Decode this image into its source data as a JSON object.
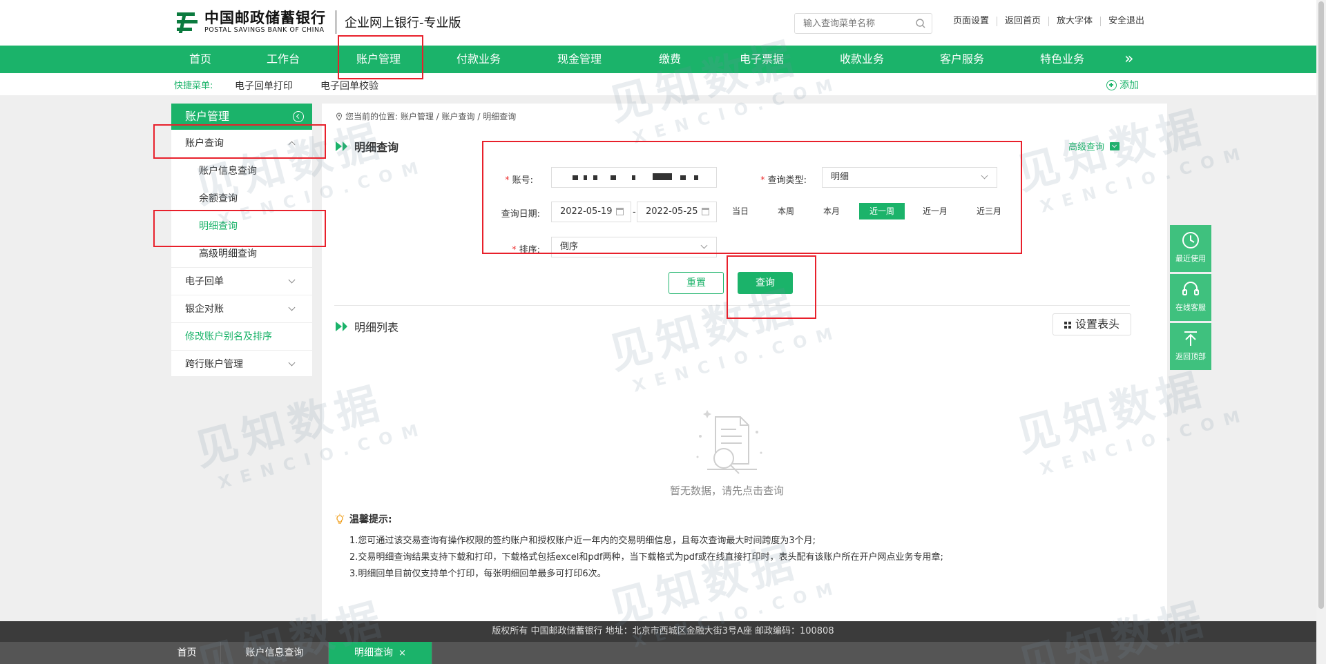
{
  "header": {
    "bank_name_cn": "中国邮政储蓄银行",
    "bank_name_en": "POSTAL SAVINGS BANK OF CHINA",
    "subtitle": "企业网上银行-专业版",
    "search_placeholder": "输入查询菜单名称",
    "links": [
      "页面设置",
      "返回首页",
      "放大字体",
      "安全退出"
    ]
  },
  "nav": {
    "items": [
      "首页",
      "工作台",
      "账户管理",
      "付款业务",
      "现金管理",
      "缴费",
      "电子票据",
      "收款业务",
      "客户服务",
      "特色业务"
    ],
    "more": "»"
  },
  "quickbar": {
    "label": "快捷菜单:",
    "items": [
      "电子回单打印",
      "电子回单校验"
    ],
    "add": "添加"
  },
  "sidebar": {
    "title": "账户管理",
    "group1": "账户查询",
    "sub": [
      "账户信息查询",
      "余额查询",
      "明细查询",
      "高级明细查询"
    ],
    "items": [
      "电子回单",
      "银企对账",
      "修改账户别名及排序",
      "跨行账户管理"
    ]
  },
  "breadcrumb": "您当前的位置: 账户管理 / 账户查询 / 明细查询",
  "query": {
    "title": "明细查询",
    "advanced": "高级查询",
    "account_label": "账号:",
    "type_label": "查询类型:",
    "type_value": "明细",
    "date_label": "查询日期:",
    "date_from": "2022-05-19",
    "date_to": "2022-05-25",
    "date_sep": "-",
    "quick_ranges": [
      "当日",
      "本周",
      "本月",
      "近一周",
      "近一月",
      "近三月"
    ],
    "active_range": "近一周",
    "sort_label": "排序:",
    "sort_value": "倒序",
    "reset": "重置",
    "submit": "查询"
  },
  "list": {
    "title": "明细列表",
    "settings": "设置表头",
    "empty": "暂无数据，请先点击查询"
  },
  "tips": {
    "title": "温馨提示:",
    "lines": [
      "1.您可通过该交易查询有操作权限的签约账户和授权账户近一年内的交易明细信息，且每次查询最大时间跨度为3个月;",
      "2.交易明细查询结果支持下载和打印，下载格式包括excel和pdf两种，当下载格式为pdf或在线直接打印时，表头配有该账户所在开户网点业务专用章;",
      "3.明细回单目前仅支持单个打印，每张明细回单最多可打印6次。"
    ]
  },
  "float": [
    "最近使用",
    "在线客服",
    "返回顶部"
  ],
  "footer": "版权所有 中国邮政储蓄银行 地址：北京市西城区金融大街3号A座 邮政编码：100808",
  "tabs": [
    "首页",
    "账户信息查询",
    "明细查询"
  ],
  "tab_close": "×",
  "watermark": {
    "cn": "见知数据",
    "en": "XENCIO.COM"
  },
  "colors": {
    "brand_green": "#1bb36a",
    "annotation_red": "#e8202b",
    "footer_dark": "#3b3b3b"
  }
}
